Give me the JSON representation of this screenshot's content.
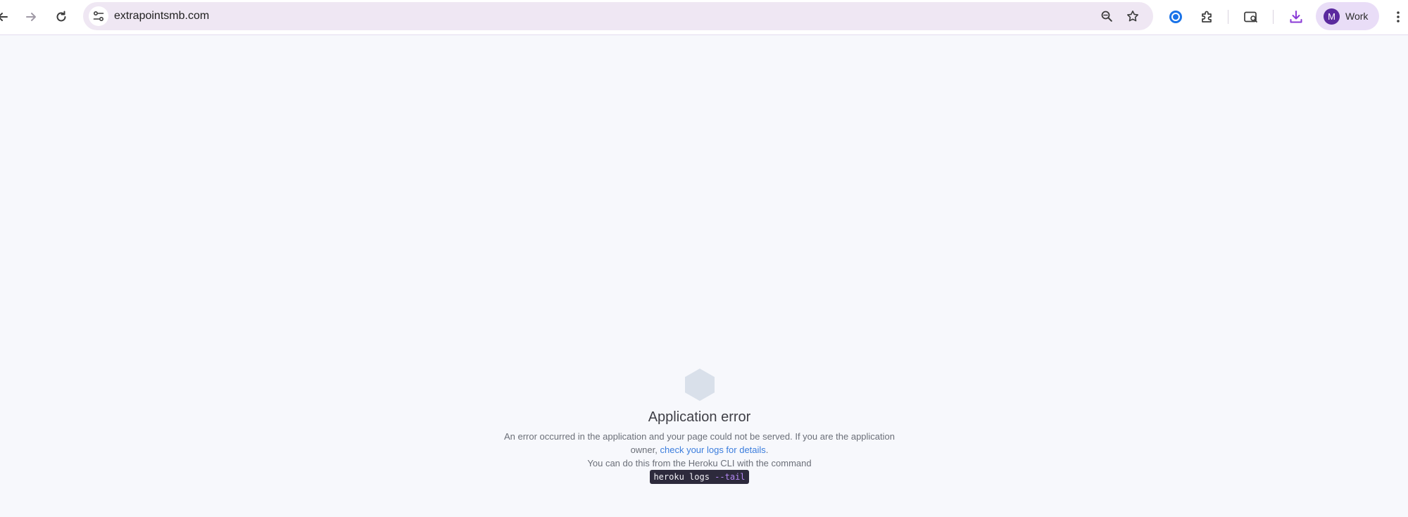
{
  "browser": {
    "url": "extrapointsmb.com",
    "profile": {
      "initial": "M",
      "label": "Work"
    },
    "icons": {
      "back": "arrow-left-icon",
      "forward": "arrow-right-icon",
      "reload": "reload-icon",
      "site_info": "tune-icon",
      "zoom": "zoom-out-icon",
      "bookmark": "star-icon",
      "extension_badge": "circle-c-icon",
      "extensions": "puzzle-icon",
      "tab_search": "tab-search-icon",
      "downloads": "download-icon",
      "menu": "kebab-menu-icon"
    },
    "colors": {
      "accent": "#8a3ad6",
      "omnibox_bg": "#efe7f3",
      "profile_chip_bg": "#e9ddf7"
    }
  },
  "page": {
    "error_title": "Application error",
    "message_part1": "An error occurred in the application and your page could not be served. If you are the application owner,",
    "message_link": "check your logs for details",
    "message_part2": ".",
    "message_line3": "You can do this from the Heroku CLI with the command",
    "command_base": "heroku logs",
    "command_flag": "--tail"
  }
}
